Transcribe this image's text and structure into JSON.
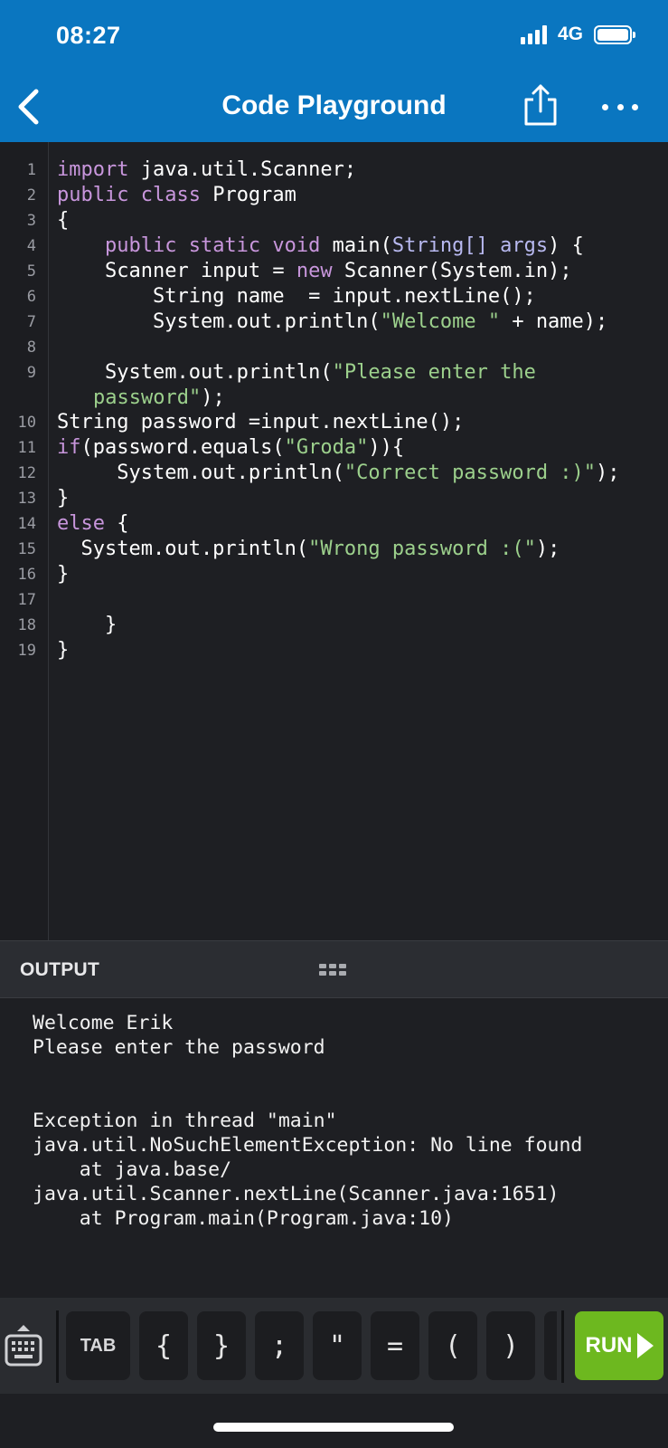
{
  "status_bar": {
    "time": "08:27",
    "network": "4G",
    "battery": 1.0
  },
  "nav": {
    "title": "Code Playground",
    "back_icon": "chevron-left-icon",
    "share_icon": "share-icon",
    "more_icon": "more-horizontal-icon"
  },
  "editor": {
    "lines": [
      {
        "n": "1",
        "parts": [
          [
            "import",
            "kw"
          ],
          [
            " java.util.Scanner;",
            ""
          ]
        ]
      },
      {
        "n": "2",
        "parts": [
          [
            "public class",
            "kw"
          ],
          [
            " Program",
            ""
          ]
        ]
      },
      {
        "n": "3",
        "parts": [
          [
            "{",
            ""
          ]
        ]
      },
      {
        "n": "4",
        "parts": [
          [
            "    ",
            ""
          ],
          [
            "public static void",
            "kw"
          ],
          [
            " main(",
            ""
          ],
          [
            "String[] args",
            "ty"
          ],
          [
            ") {",
            ""
          ]
        ]
      },
      {
        "n": "5",
        "parts": [
          [
            "    Scanner input = ",
            ""
          ],
          [
            "new",
            "kw"
          ],
          [
            " Scanner(System.in);",
            ""
          ]
        ]
      },
      {
        "n": "6",
        "parts": [
          [
            "        String name  = input.nextLine();",
            ""
          ]
        ]
      },
      {
        "n": "7",
        "parts": [
          [
            "        System.out.println(",
            ""
          ],
          [
            "\"Welcome \"",
            "st"
          ],
          [
            " + name);",
            ""
          ]
        ]
      },
      {
        "n": "8",
        "parts": [
          [
            "",
            ""
          ]
        ]
      },
      {
        "n": "9",
        "parts": [
          [
            "    System.out.println(",
            ""
          ],
          [
            "\"Please enter the",
            "st"
          ]
        ]
      },
      {
        "n": "",
        "cont": true,
        "parts": [
          [
            "password\"",
            "st"
          ],
          [
            ");",
            ""
          ]
        ]
      },
      {
        "n": "10",
        "parts": [
          [
            "String password =input.nextLine();",
            ""
          ]
        ]
      },
      {
        "n": "11",
        "parts": [
          [
            "if",
            "kw"
          ],
          [
            "(password.equals(",
            ""
          ],
          [
            "\"Groda\"",
            "st"
          ],
          [
            "))",
            ""
          ],
          [
            "{",
            ""
          ]
        ]
      },
      {
        "n": "12",
        "parts": [
          [
            "     System.out.println(",
            ""
          ],
          [
            "\"Correct password :)\"",
            "st"
          ],
          [
            ");",
            ""
          ]
        ]
      },
      {
        "n": "13",
        "parts": [
          [
            "}",
            ""
          ]
        ]
      },
      {
        "n": "14",
        "parts": [
          [
            "else",
            "kw"
          ],
          [
            " {",
            ""
          ]
        ]
      },
      {
        "n": "15",
        "parts": [
          [
            "  System.out.println(",
            ""
          ],
          [
            "\"Wrong password :(\"",
            "st"
          ],
          [
            ");",
            ""
          ]
        ]
      },
      {
        "n": "16",
        "parts": [
          [
            "}",
            ""
          ]
        ]
      },
      {
        "n": "17",
        "parts": [
          [
            "",
            ""
          ]
        ]
      },
      {
        "n": "18",
        "parts": [
          [
            "    }",
            ""
          ]
        ]
      },
      {
        "n": "19",
        "parts": [
          [
            "}",
            ""
          ]
        ]
      }
    ]
  },
  "output": {
    "title": "OUTPUT",
    "grip_icon": "drag-handle-icon",
    "text": "Welcome Erik\nPlease enter the password\n\n\nException in thread \"main\"\njava.util.NoSuchElementException: No line found\n    at java.base/\njava.util.Scanner.nextLine(Scanner.java:1651)\n    at Program.main(Program.java:10)"
  },
  "toolbar": {
    "keyboard_icon": "keyboard-icon",
    "keys": [
      "TAB",
      "{",
      "}",
      ";",
      "\"",
      "=",
      "(",
      ")"
    ],
    "run_label": "RUN",
    "run_icon": "play-arrow-icon"
  }
}
